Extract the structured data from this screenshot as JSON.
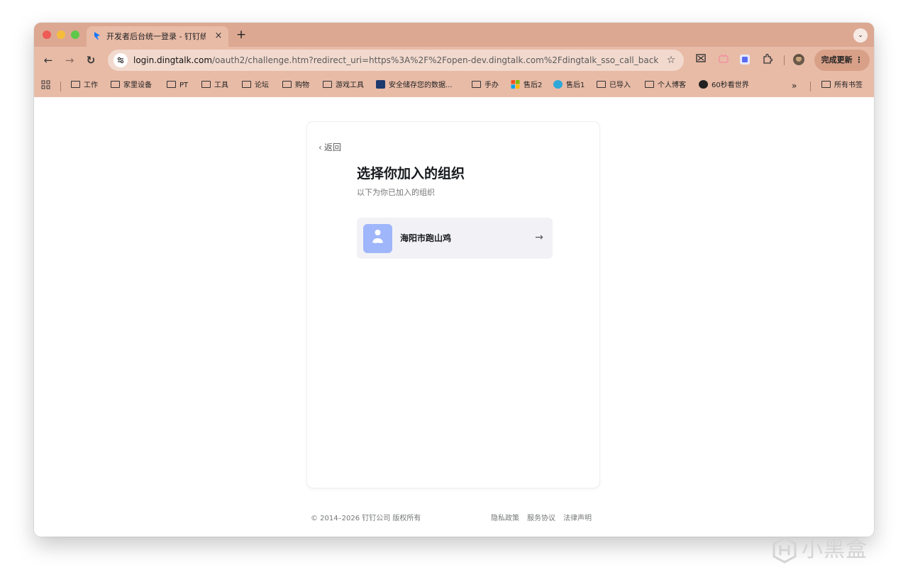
{
  "browser": {
    "tab_title": "开发者后台统一登录 - 钉钉统一",
    "tab_close": "×",
    "new_tab": "+",
    "tab_search": "⌄",
    "url_host": "login.dingtalk.com",
    "url_path": "/oauth2/challenge.htm?redirect_uri=https%3A%2F%2Fopen-dev.dingtalk.com%2Fdingtalk_sso_call_back%3...",
    "update_button": "完成更新 ⋮",
    "bookmarks": {
      "items": [
        "工作",
        "家里设备",
        "PT",
        "工具",
        "论坛",
        "购物",
        "游戏工具",
        "安全储存您的数据...",
        "手办",
        "售后2",
        "售后1",
        "已导入",
        "个人博客",
        "60秒看世界"
      ],
      "overflow": "»",
      "all_bookmarks": "所有书签"
    }
  },
  "page": {
    "back_label": "返回",
    "title": "选择你加入的组织",
    "subtitle": "以下为你已加入的组织",
    "orgs": [
      {
        "name": "海阳市跑山鸡"
      }
    ],
    "footer": {
      "copyright": "© 2014–2026 钉钉公司 版权所有",
      "links": [
        "隐私政策",
        "服务协议",
        "法律声明"
      ]
    }
  },
  "watermark": {
    "text": "小黑盒"
  },
  "colors": {
    "tabstrip": "#dca892",
    "toolbar": "#e8bba7",
    "org_avatar": "#9fb6fb",
    "org_item_bg": "#f2f2f6"
  }
}
